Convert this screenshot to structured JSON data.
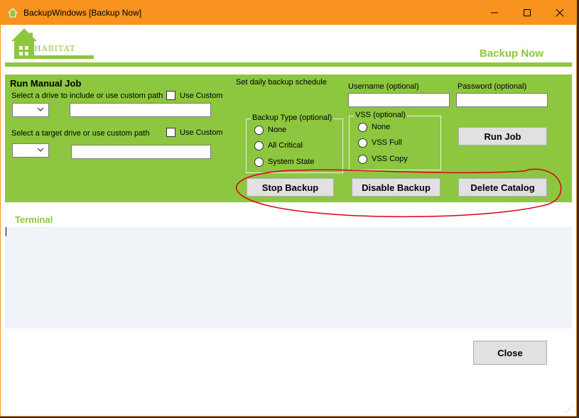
{
  "window": {
    "title": "BackupWindows [Backup Now]",
    "icon": "home-icon",
    "controls": [
      "minimize-icon",
      "maximize-icon",
      "close-icon"
    ]
  },
  "header": {
    "logo_text": "HABITAT",
    "page_title": "Backup Now"
  },
  "manual_job": {
    "heading": "Run Manual Job",
    "source_label": "Select a drive to include or use custom path",
    "source_use_custom": "Use Custom",
    "source_drive_value": "",
    "source_path_value": "",
    "target_label": "Select a target drive or use custom path",
    "target_use_custom": "Use Custom",
    "target_drive_value": "",
    "target_path_value": ""
  },
  "schedule": {
    "label": "Set daily backup schedule",
    "username_label": "Username (optional)",
    "username_value": "",
    "password_label": "Password (optional)",
    "password_value": ""
  },
  "backup_type": {
    "title": "Backup Type (optional)",
    "options": [
      "None",
      "All Critical",
      "System State"
    ]
  },
  "vss": {
    "title": "VSS (optional)",
    "options": [
      "None",
      "VSS Full",
      "VSS Copy"
    ]
  },
  "buttons": {
    "run_job": "Run Job",
    "stop_backup": "Stop Backup",
    "disable_backup": "Disable Backup",
    "delete_catalog": "Delete Catalog",
    "close": "Close"
  },
  "terminal": {
    "title": "Terminal",
    "content": ""
  },
  "colors": {
    "title_bar": "#f7931e",
    "accent_green": "#8dc63f",
    "annotation_red": "#d9001b",
    "terminal_bg": "#f0f4f8"
  }
}
